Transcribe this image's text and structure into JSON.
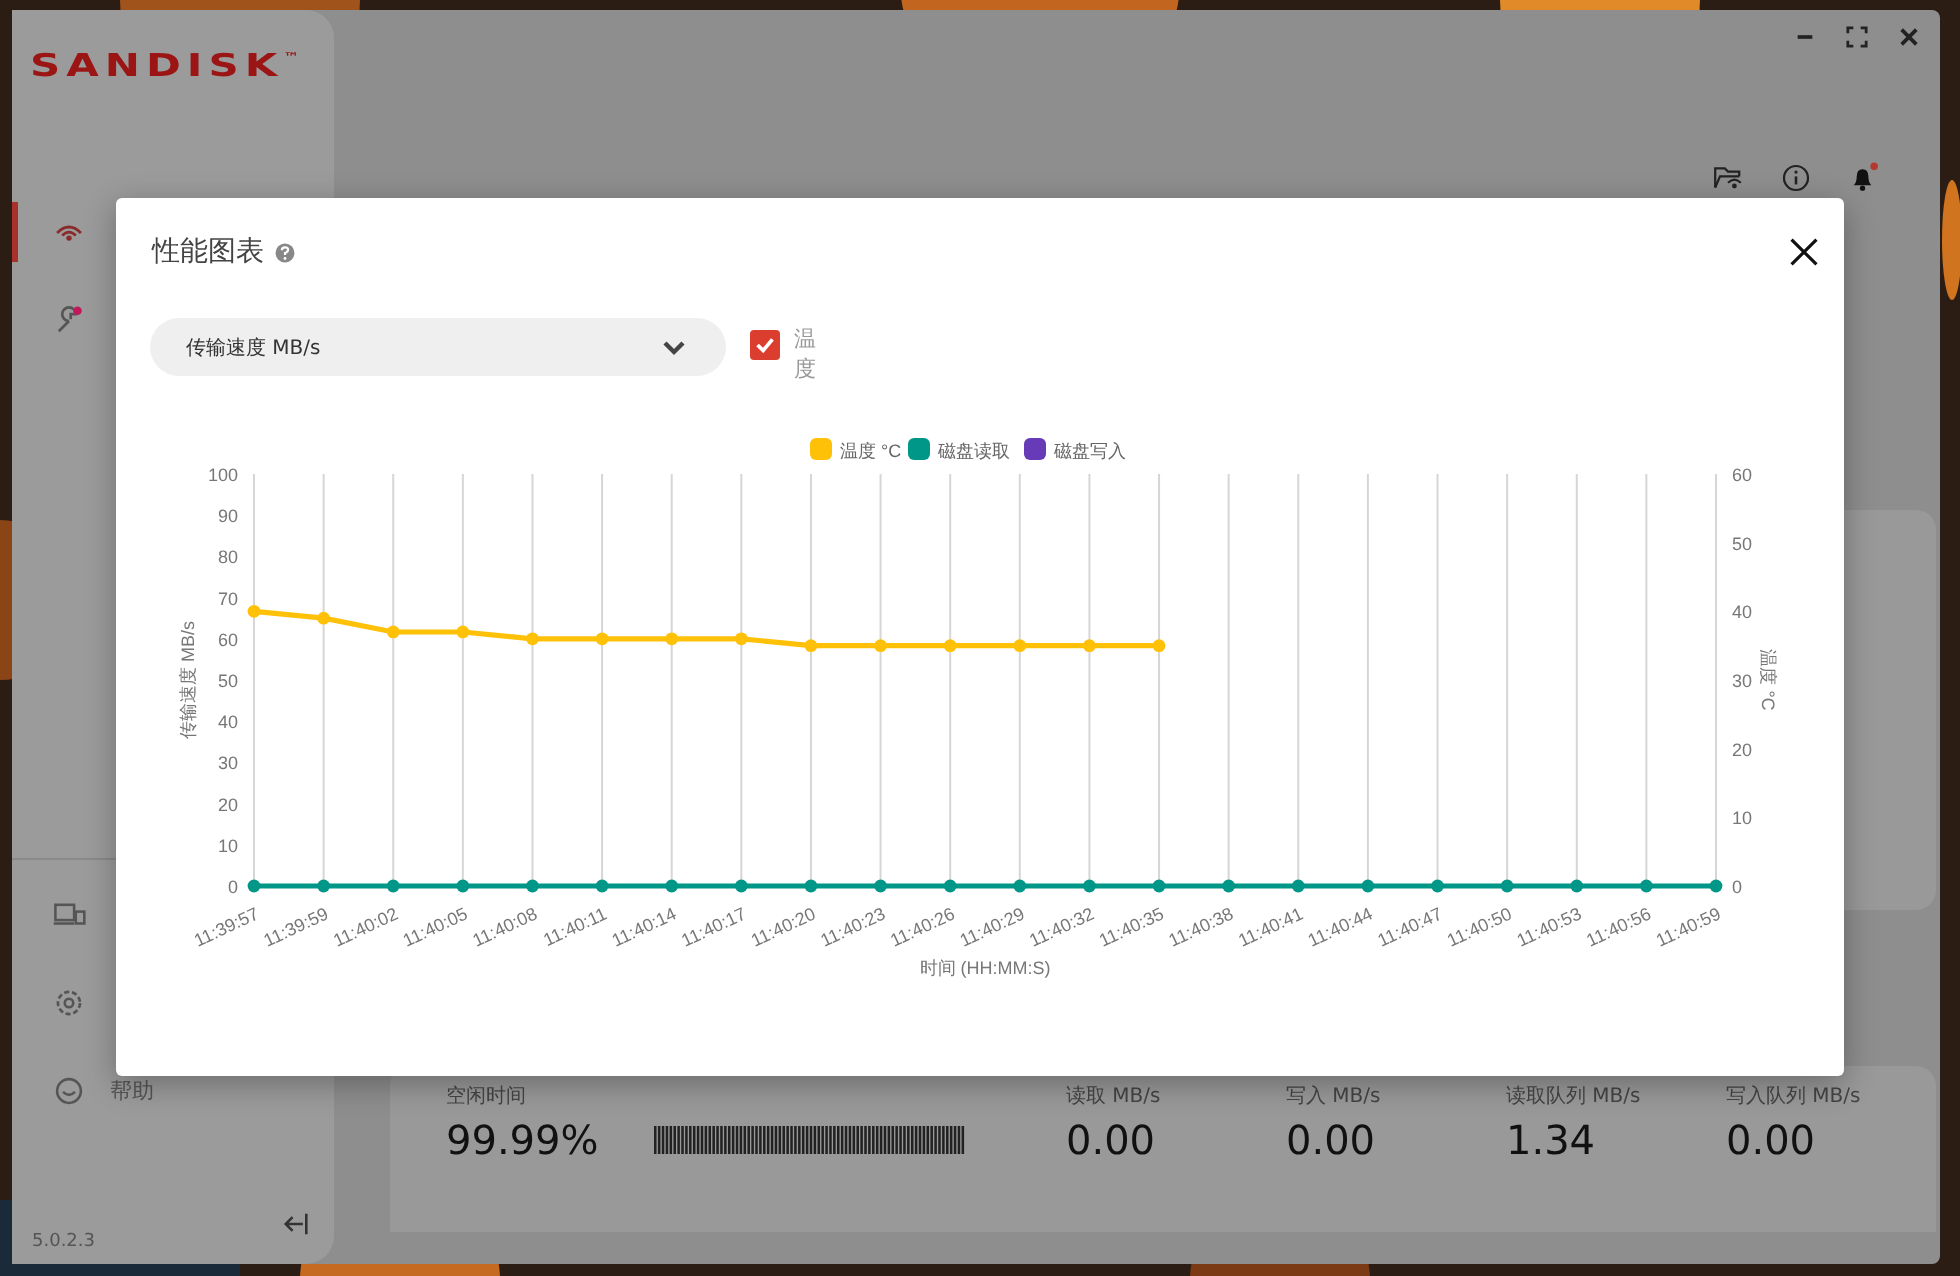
{
  "app": {
    "logo": "SANDISK",
    "logo_mark": "™",
    "version": "5.0.2.3"
  },
  "sidebar": {
    "help_label": "帮助"
  },
  "stats": [
    {
      "label": "空闲时间",
      "value": "99.99%",
      "kind": "idle"
    },
    {
      "label": "读取 MB/s",
      "value": "0.00",
      "kind": "plain"
    },
    {
      "label": "写入 MB/s",
      "value": "0.00",
      "kind": "plain"
    },
    {
      "label": "读取队列 MB/s",
      "value": "1.34",
      "kind": "plain"
    },
    {
      "label": "写入队列 MB/s",
      "value": "0.00",
      "kind": "plain"
    }
  ],
  "dialog": {
    "title": "性能图表",
    "metric_select": {
      "value": "传输速度 MB/s"
    },
    "temperature_toggle": {
      "label": "温度",
      "checked": true
    },
    "chart_data": {
      "type": "line",
      "xlabel": "时间 (HH:MM:S)",
      "ylabel": "传输速度 MB/s",
      "y2label": "温度 °C",
      "categories": [
        "11:39:57",
        "11:39:59",
        "11:40:02",
        "11:40:05",
        "11:40:08",
        "11:40:11",
        "11:40:14",
        "11:40:17",
        "11:40:20",
        "11:40:23",
        "11:40:26",
        "11:40:29",
        "11:40:32",
        "11:40:35",
        "11:40:38",
        "11:40:41",
        "11:40:44",
        "11:40:47",
        "11:40:50",
        "11:40:53",
        "11:40:56",
        "11:40:59"
      ],
      "series": [
        {
          "name": "温度 °C",
          "color": "#ffc107",
          "axis": "y2",
          "marker": "circle",
          "values": [
            40,
            39,
            37,
            37,
            36,
            36,
            36,
            36,
            35,
            35,
            35,
            35,
            35,
            35,
            null,
            null,
            null,
            null,
            null,
            null,
            null,
            null
          ]
        },
        {
          "name": "磁盘读取",
          "color": "#009688",
          "marker": "circle",
          "values": [
            0,
            0,
            0,
            0,
            0,
            0,
            0,
            0,
            0,
            0,
            0,
            0,
            0,
            0,
            0,
            0,
            0,
            0,
            0,
            0,
            0,
            0
          ]
        },
        {
          "name": "磁盘写入",
          "color": "#673ab7",
          "values": [
            null,
            null,
            null,
            null,
            null,
            null,
            null,
            null,
            null,
            null,
            null,
            null,
            null,
            null,
            null,
            null,
            null,
            null,
            null,
            null,
            null,
            null
          ]
        }
      ],
      "legend": "top",
      "ylim": [
        0,
        100
      ],
      "yticks": [
        0,
        10,
        20,
        30,
        40,
        50,
        60,
        70,
        80,
        90,
        100
      ],
      "y2lim": [
        0,
        60
      ],
      "y2ticks": [
        0,
        10,
        20,
        30,
        40,
        50,
        60
      ]
    }
  }
}
